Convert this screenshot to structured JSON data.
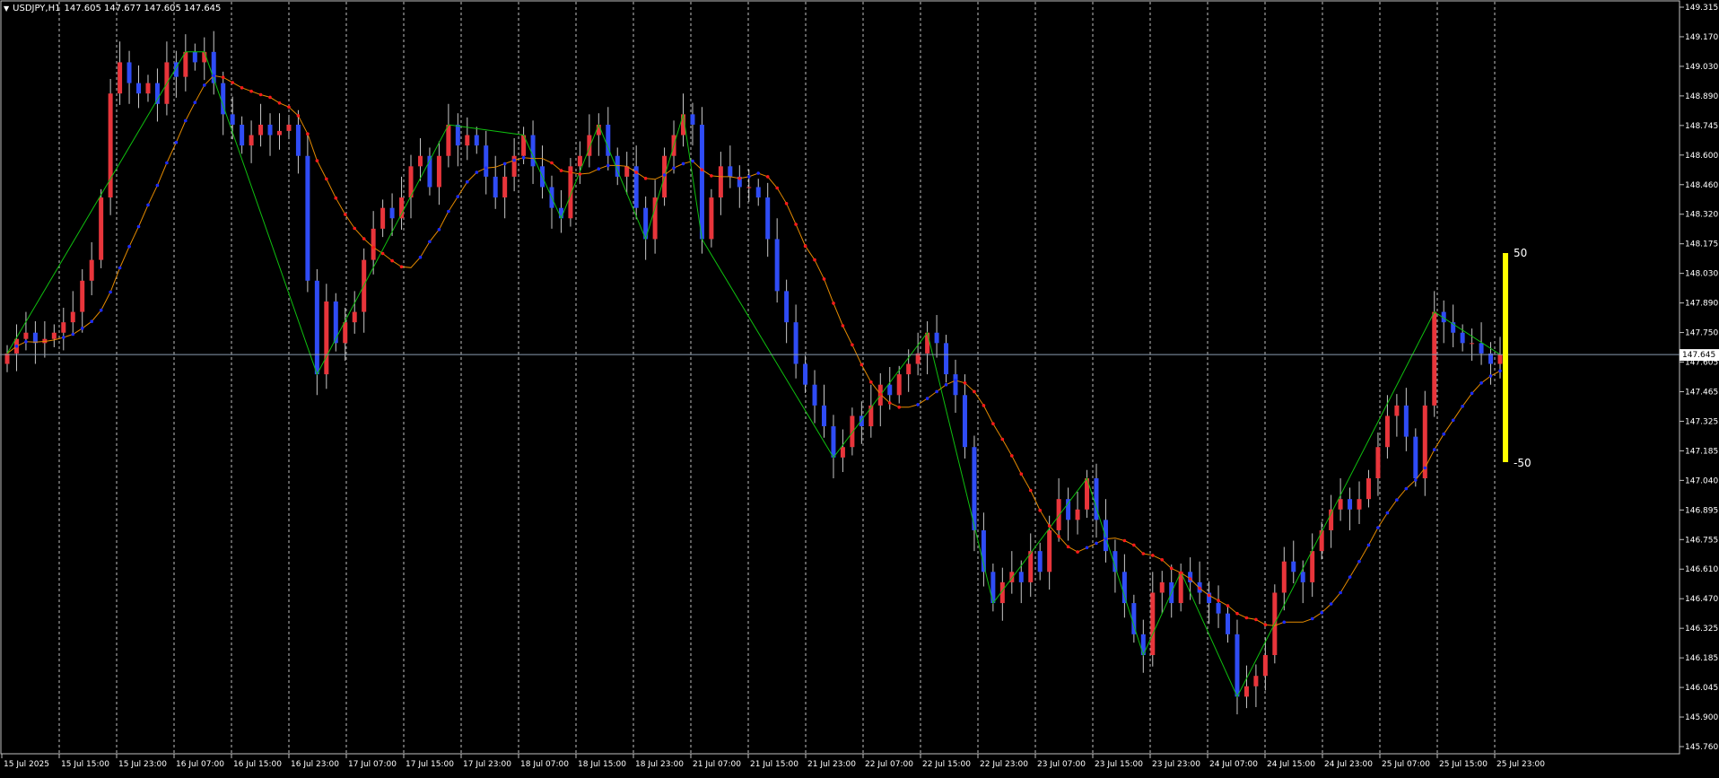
{
  "header": {
    "dropdown_icon": "triangle-down-icon",
    "symbol": "USDJPY,H1",
    "ohlc": "147.605 147.677 147.605 147.645"
  },
  "colors": {
    "background": "#000000",
    "grid": "#c0c0c0",
    "bull_candle": "#e8353b",
    "bear_candle": "#2f4cf5",
    "wick": "#c8c8c8",
    "zigzag": "#0fbf0f",
    "ma_line": "#e48a00",
    "dots_up": "#1c2cff",
    "dots_down": "#ff1a1a",
    "bid_line": "#8a9db0",
    "bar_indicator": "#ffff00",
    "text": "#ffffff"
  },
  "price_axis": {
    "labels": [
      "149.315",
      "149.170",
      "149.030",
      "148.890",
      "148.745",
      "148.600",
      "148.460",
      "148.320",
      "148.175",
      "148.030",
      "147.890",
      "147.750",
      "147.605",
      "147.465",
      "147.325",
      "147.185",
      "147.040",
      "146.895",
      "146.755",
      "146.610",
      "146.470",
      "146.325",
      "146.185",
      "146.045",
      "145.900",
      "145.760"
    ],
    "current_price": "147.645"
  },
  "time_axis": {
    "labels": [
      "15 Jul 2025",
      "15 Jul 15:00",
      "15 Jul 23:00",
      "16 Jul 07:00",
      "16 Jul 15:00",
      "16 Jul 23:00",
      "17 Jul 07:00",
      "17 Jul 15:00",
      "17 Jul 23:00",
      "18 Jul 07:00",
      "18 Jul 15:00",
      "18 Jul 23:00",
      "21 Jul 07:00",
      "21 Jul 15:00",
      "21 Jul 23:00",
      "22 Jul 07:00",
      "22 Jul 15:00",
      "22 Jul 23:00",
      "23 Jul 07:00",
      "23 Jul 15:00",
      "23 Jul 23:00",
      "24 Jul 07:00",
      "24 Jul 15:00",
      "24 Jul 23:00",
      "25 Jul 07:00",
      "25 Jul 15:00",
      "25 Jul 23:00"
    ]
  },
  "indicator_labels": {
    "top": "50",
    "bottom": "-50"
  },
  "chart_data": {
    "type": "candlestick",
    "symbol": "USDJPY",
    "timeframe": "H1",
    "ylim": [
      145.76,
      149.315
    ],
    "grid": "vertical-dashed",
    "closes": [
      147.65,
      147.72,
      147.75,
      147.7,
      147.72,
      147.75,
      147.8,
      147.85,
      148.0,
      148.1,
      148.4,
      148.9,
      149.05,
      148.95,
      148.9,
      148.95,
      148.85,
      149.05,
      148.98,
      149.1,
      149.05,
      149.1,
      148.95,
      148.8,
      148.75,
      148.65,
      148.7,
      148.75,
      148.7,
      148.72,
      148.75,
      148.6,
      148.0,
      147.55,
      147.9,
      147.7,
      147.8,
      147.85,
      148.1,
      148.25,
      148.35,
      148.3,
      148.4,
      148.55,
      148.6,
      148.45,
      148.6,
      148.75,
      148.65,
      148.7,
      148.65,
      148.5,
      148.4,
      148.5,
      148.6,
      148.7,
      148.55,
      148.45,
      148.35,
      148.3,
      148.55,
      148.6,
      148.7,
      148.75,
      148.6,
      148.5,
      148.55,
      148.35,
      148.2,
      148.4,
      148.6,
      148.7,
      148.8,
      148.75,
      148.2,
      148.4,
      148.55,
      148.5,
      148.45,
      148.45,
      148.4,
      148.2,
      147.95,
      147.8,
      147.6,
      147.5,
      147.4,
      147.3,
      147.15,
      147.2,
      147.35,
      147.3,
      147.4,
      147.5,
      147.45,
      147.55,
      147.6,
      147.65,
      147.75,
      147.7,
      147.55,
      147.45,
      147.2,
      146.8,
      146.6,
      146.45,
      146.55,
      146.6,
      146.55,
      146.7,
      146.6,
      146.8,
      146.95,
      146.85,
      146.9,
      147.05,
      146.85,
      146.7,
      146.6,
      146.45,
      146.3,
      146.2,
      146.5,
      146.55,
      146.45,
      146.6,
      146.55,
      146.5,
      146.45,
      146.4,
      146.3,
      146.0,
      146.05,
      146.1,
      146.2,
      146.5,
      146.65,
      146.6,
      146.55,
      146.7,
      146.8,
      146.9,
      146.95,
      146.9,
      146.95,
      147.05,
      147.2,
      147.35,
      147.4,
      147.25,
      147.05,
      147.4,
      147.85,
      147.8,
      147.75,
      147.7,
      147.7,
      147.65,
      147.6,
      147.645
    ]
  }
}
